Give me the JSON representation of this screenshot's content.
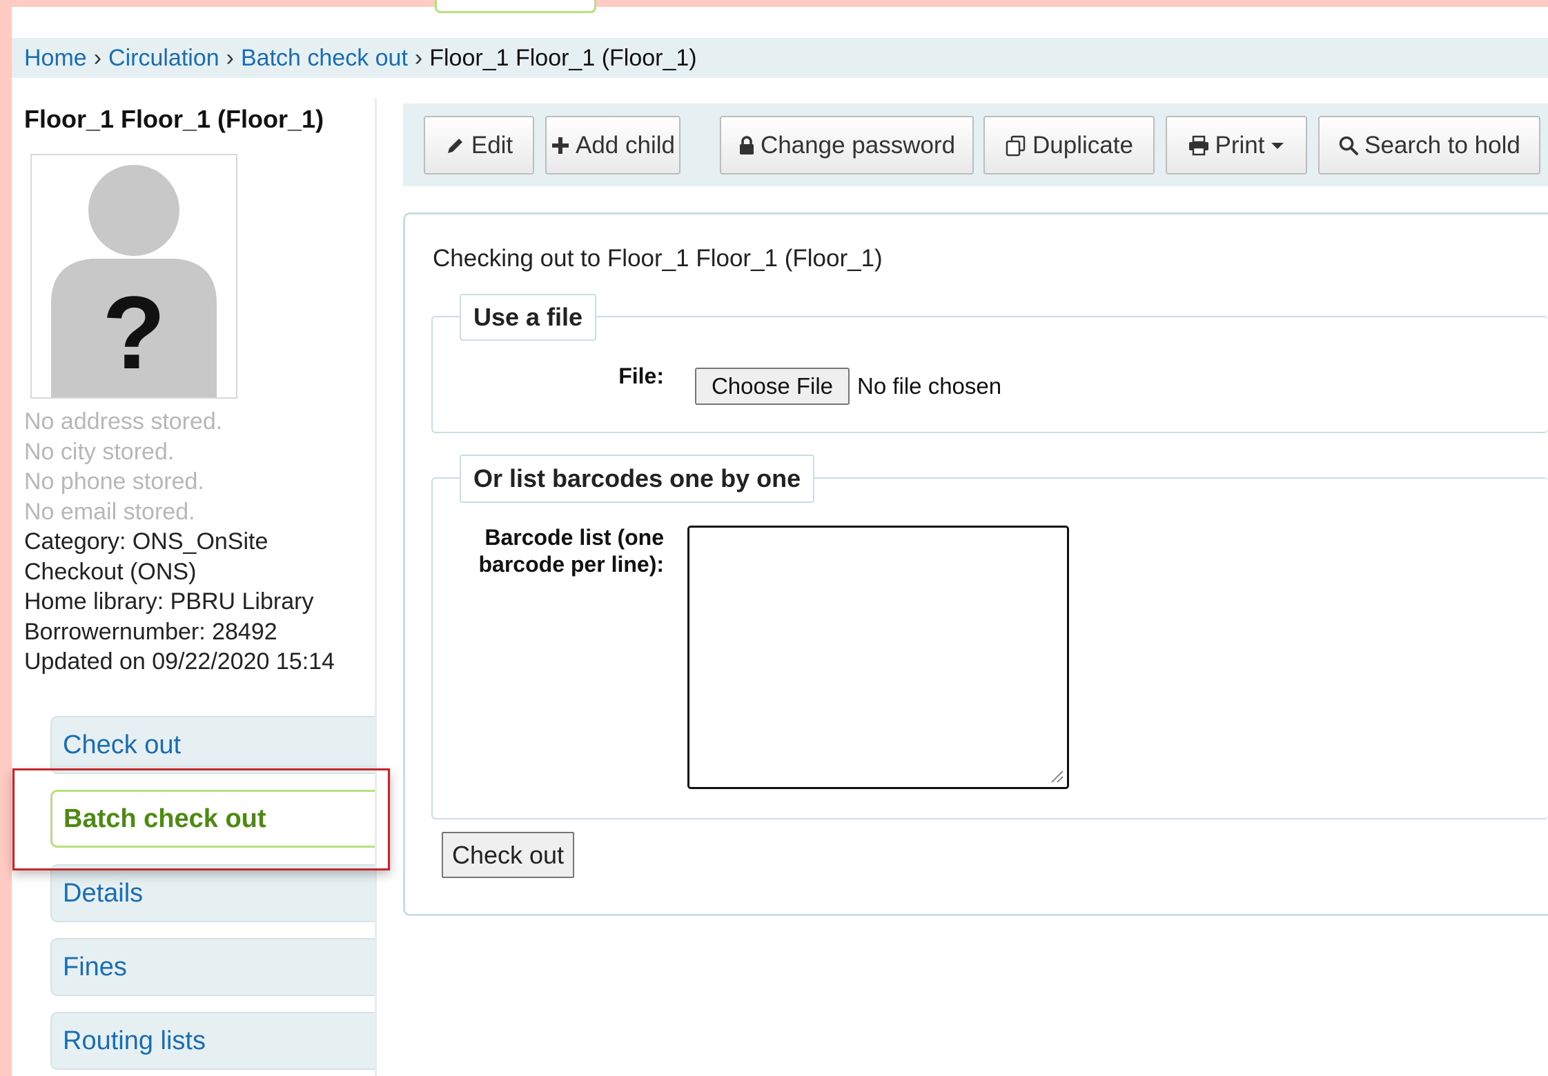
{
  "breadcrumb": {
    "home": "Home",
    "circulation": "Circulation",
    "batch_checkout": "Batch check out",
    "current": "Floor_1 Floor_1 (Floor_1)",
    "separator": "›"
  },
  "patron": {
    "name": "Floor_1 Floor_1 (Floor_1)",
    "no_address": "No address stored.",
    "no_city": "No city stored.",
    "no_phone": "No phone stored.",
    "no_email": "No email stored.",
    "category_line1": "Category: ONS_OnSite",
    "category_line2": "Checkout (ONS)",
    "home_library": "Home library: PBRU Library",
    "borrowernumber": "Borrowernumber: 28492",
    "updated": "Updated on 09/22/2020 15:14",
    "photo_placeholder": "?"
  },
  "nav": {
    "checkout": "Check out",
    "batch_checkout": "Batch check out",
    "details": "Details",
    "fines": "Fines",
    "routing_lists": "Routing lists"
  },
  "toolbar": {
    "edit": "Edit",
    "add_child": "Add child",
    "change_password": "Change password",
    "duplicate": "Duplicate",
    "print": "Print",
    "search_to_hold": "Search to hold"
  },
  "main": {
    "checking_out_to": "Checking out to Floor_1 Floor_1 (Floor_1)",
    "use_file_legend": "Use a file",
    "file_label": "File:",
    "choose_file": "Choose File",
    "no_file": "No file chosen",
    "list_legend": "Or list barcodes one by one",
    "barcode_label_line1": "Barcode list (one",
    "barcode_label_line2": "barcode per line):",
    "barcode_value": "",
    "submit": "Check out"
  },
  "colors": {
    "link": "#1a6db3",
    "active_tab_text": "#4c8b10",
    "active_tab_border": "#b9e07e",
    "highlight": "#c1272d",
    "toolbar_bg": "#e6f0f2"
  }
}
